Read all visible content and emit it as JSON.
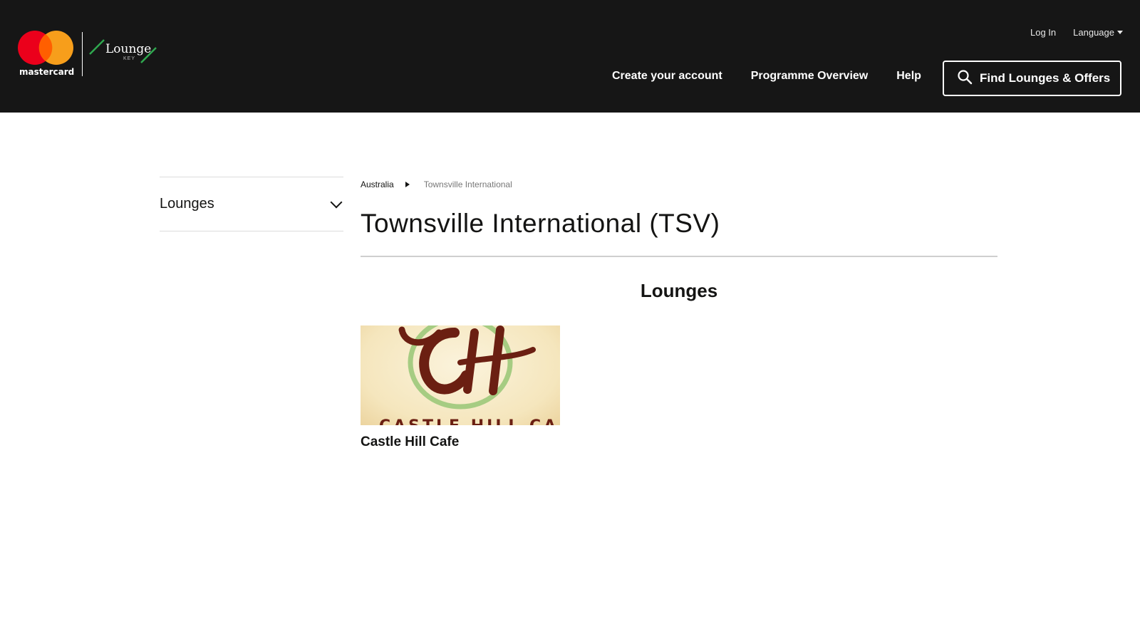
{
  "brand": {
    "wordmark": "mastercard",
    "product_name": "Lounge",
    "product_sub": "KEY",
    "colors": {
      "red": "#eb001b",
      "orange": "#f79e1b",
      "green": "#2fa84f",
      "header_bg": "#161616"
    }
  },
  "utility_nav": {
    "login": "Log In",
    "language": "Language"
  },
  "main_nav": {
    "items": [
      {
        "label": "Create your account"
      },
      {
        "label": "Programme Overview"
      },
      {
        "label": "Help"
      }
    ],
    "find_button": {
      "label": "Find Lounges & Offers",
      "icon": "search-icon"
    }
  },
  "sidebar": {
    "items": [
      {
        "label": "Lounges",
        "icon": "chevron-down-icon"
      }
    ]
  },
  "breadcrumb": {
    "items": [
      "Australia",
      "Townsville International"
    ]
  },
  "page": {
    "title": "Townsville International (TSV)",
    "section_title": "Lounges"
  },
  "lounges": [
    {
      "name": "Castle Hill Cafe",
      "image_logo_text": "CASTLE HILL CAFE",
      "image_monogram": "CH"
    }
  ]
}
